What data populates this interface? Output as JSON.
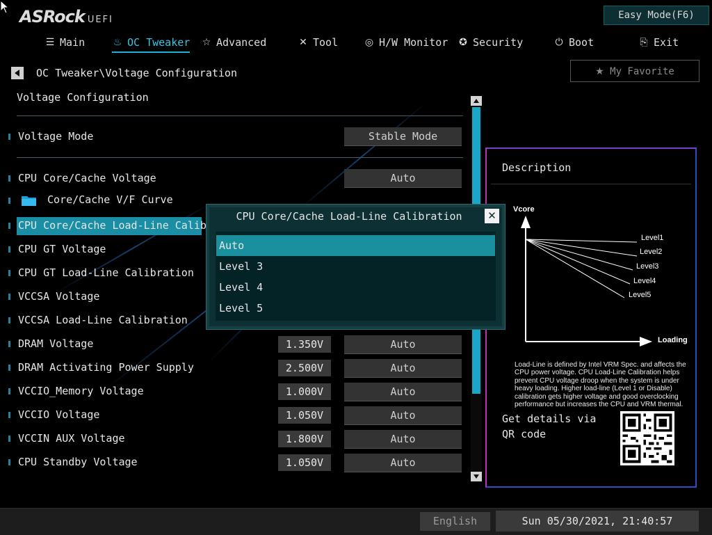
{
  "header": {
    "brand": "ASRock",
    "brand_suffix": "UEFI",
    "easy_mode_label": "Easy Mode(F6)"
  },
  "nav": [
    {
      "label": "Main",
      "icon": "list-icon"
    },
    {
      "label": "OC Tweaker",
      "icon": "flame-icon",
      "active": true
    },
    {
      "label": "Advanced",
      "icon": "star-icon"
    },
    {
      "label": "Tool",
      "icon": "tools-icon"
    },
    {
      "label": "H/W Monitor",
      "icon": "monitor-icon"
    },
    {
      "label": "Security",
      "icon": "shield-icon"
    },
    {
      "label": "Boot",
      "icon": "power-icon"
    },
    {
      "label": "Exit",
      "icon": "exit-icon"
    }
  ],
  "breadcrumb": "OC Tweaker\\Voltage Configuration",
  "favorite_label": "My Favorite",
  "section_title": "Voltage Configuration",
  "rows": [
    {
      "label": "Voltage Mode",
      "option": "Stable Mode"
    },
    {
      "label": "CPU Core/Cache Voltage",
      "option": "Auto"
    },
    {
      "label": "Core/Cache V/F Curve",
      "folder": true
    },
    {
      "label": "CPU Core/Cache Load-Line Calibrat",
      "selected": true
    },
    {
      "label": "CPU GT Voltage"
    },
    {
      "label": "CPU GT Load-Line Calibration"
    },
    {
      "label": "VCCSA Voltage"
    },
    {
      "label": "VCCSA Load-Line Calibration"
    },
    {
      "label": "DRAM Voltage",
      "value": "1.350V",
      "option": "Auto"
    },
    {
      "label": "DRAM Activating Power Supply",
      "value": "2.500V",
      "option": "Auto"
    },
    {
      "label": "VCCIO_Memory Voltage",
      "value": "1.000V",
      "option": "Auto"
    },
    {
      "label": "VCCIO Voltage",
      "value": "1.050V",
      "option": "Auto"
    },
    {
      "label": "VCCIN AUX Voltage",
      "value": "1.800V",
      "option": "Auto"
    },
    {
      "label": "CPU Standby Voltage",
      "value": "1.050V",
      "option": "Auto"
    }
  ],
  "popup": {
    "title": "CPU Core/Cache Load-Line Calibration",
    "options": [
      "Auto",
      "Level 3",
      "Level 4",
      "Level 5"
    ],
    "selected_index": 0
  },
  "description": {
    "title": "Description",
    "graph": {
      "y_label": "Vcore",
      "x_label": "Loading",
      "levels": [
        "Level1",
        "Level2",
        "Level3",
        "Level4",
        "Level5"
      ]
    },
    "text": "Load-Line is defined by Intel VRM Spec. and affects the CPU power voltage. CPU Load-Line Calibration helps prevent CPU voltage droop when the system is under heavy loading. Higher load-line (Level 1 or Disable) calibration gets higher voltage and good overclocking performance but increases the CPU and VRM thermal.",
    "qr_text": "Get details via QR code"
  },
  "footer": {
    "language": "English",
    "datetime": "Sun 05/30/2021, 21:40:57"
  },
  "colors": {
    "accent": "#19b3d8",
    "selection": "#198ea4",
    "popup_bg": "#0c3034"
  }
}
